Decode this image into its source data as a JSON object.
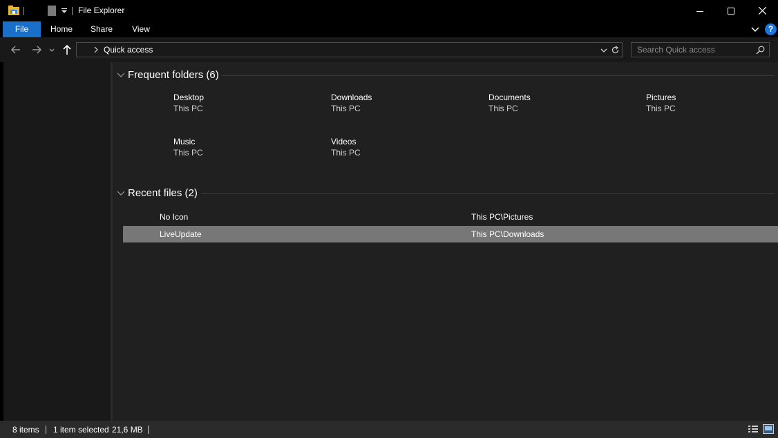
{
  "window": {
    "title": "File Explorer",
    "minimize_icon": "minimize-icon",
    "maximize_icon": "maximize-icon",
    "close_icon": "close-icon"
  },
  "ribbon": {
    "tabs": [
      {
        "label": "File",
        "active": true
      },
      {
        "label": "Home"
      },
      {
        "label": "Share"
      },
      {
        "label": "View"
      }
    ],
    "help_label": "?"
  },
  "address": {
    "path": "Quick access"
  },
  "search": {
    "placeholder": "Search Quick access"
  },
  "main": {
    "frequent": {
      "title": "Frequent folders (6)",
      "items": [
        {
          "name": "Desktop",
          "location": "This PC"
        },
        {
          "name": "Downloads",
          "location": "This PC"
        },
        {
          "name": "Documents",
          "location": "This PC"
        },
        {
          "name": "Pictures",
          "location": "This PC"
        },
        {
          "name": "Music",
          "location": "This PC"
        },
        {
          "name": "Videos",
          "location": "This PC"
        }
      ]
    },
    "recent": {
      "title": "Recent files (2)",
      "items": [
        {
          "name": "No Icon",
          "path": "This PC\\Pictures",
          "selected": false
        },
        {
          "name": "LiveUpdate",
          "path": "This PC\\Downloads",
          "selected": true
        }
      ]
    }
  },
  "status": {
    "item_count": "8 items",
    "selection": "1 item selected",
    "size": "21,6 MB"
  },
  "colors": {
    "accent": "#1a6fc9",
    "selection": "#777777",
    "content_bg": "#202020"
  }
}
